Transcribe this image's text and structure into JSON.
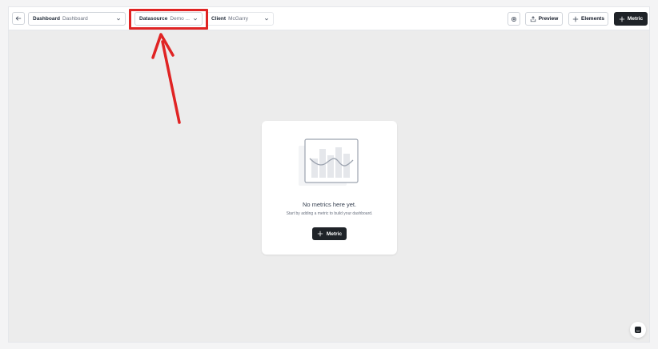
{
  "topbar": {
    "dashboard": {
      "label": "Dashboard",
      "value": "Dashboard"
    },
    "datasource": {
      "label": "Datasource",
      "value": "Demo ..."
    },
    "client": {
      "label": "Client",
      "value": "McGarry"
    },
    "preview_label": "Preview",
    "elements_label": "Elements",
    "metric_label": "Metric"
  },
  "empty_state": {
    "title": "No metrics here yet.",
    "subtitle": "Start by adding a metric to build your dashboard.",
    "button_label": "Metric"
  },
  "annotation": {
    "color": "#e02424"
  },
  "icons": [
    "arrow-left-icon",
    "chevron-down-icon",
    "settings-icon",
    "share-icon",
    "plus-icon",
    "chat-icon"
  ]
}
